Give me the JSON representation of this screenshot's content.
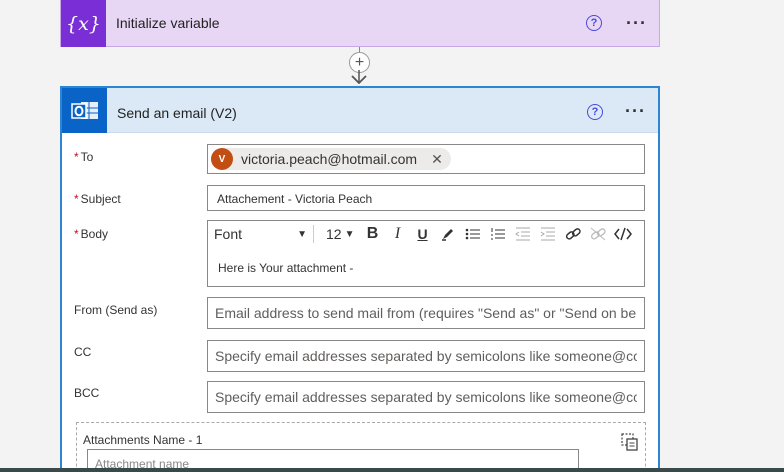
{
  "variable_card": {
    "icon_text": "{x}",
    "title": "Initialize variable",
    "help": "?",
    "more": "···"
  },
  "connector": {
    "add_symbol": "+"
  },
  "email_card": {
    "title": "Send an email (V2)",
    "help": "?",
    "more": "···",
    "fields": {
      "to_label": "To",
      "subject_label": "Subject",
      "body_label": "Body",
      "from_label": "From (Send as)",
      "cc_label": "CC",
      "bcc_label": "BCC",
      "required_mark": "*"
    },
    "to_chip": {
      "avatar": "V",
      "email": "victoria.peach@hotmail.com",
      "close": "✕"
    },
    "subject_value": "Attachement - Victoria Peach",
    "toolbar": {
      "font": "Font",
      "size": "12",
      "caret": "▼",
      "bold": "B",
      "italic": "I",
      "underline": "U"
    },
    "body_value": "Here is Your attachment -",
    "from_placeholder": "Email address to send mail from (requires \"Send as\" or \"Send on beh",
    "cc_placeholder": "Specify email addresses separated by semicolons like someone@con",
    "bcc_placeholder": "Specify email addresses separated by semicolons like someone@con",
    "attachments": {
      "label": "Attachments Name - 1",
      "placeholder": "Attachment name"
    }
  },
  "colors": {
    "variable_accent": "#7a2fd6",
    "variable_bg": "#e8d6f5",
    "email_accent": "#0a64c8",
    "email_header_bg": "#dbe9f6",
    "card_border": "#2c84d4",
    "required": "#c50f1f",
    "avatar": "#c24e14"
  }
}
